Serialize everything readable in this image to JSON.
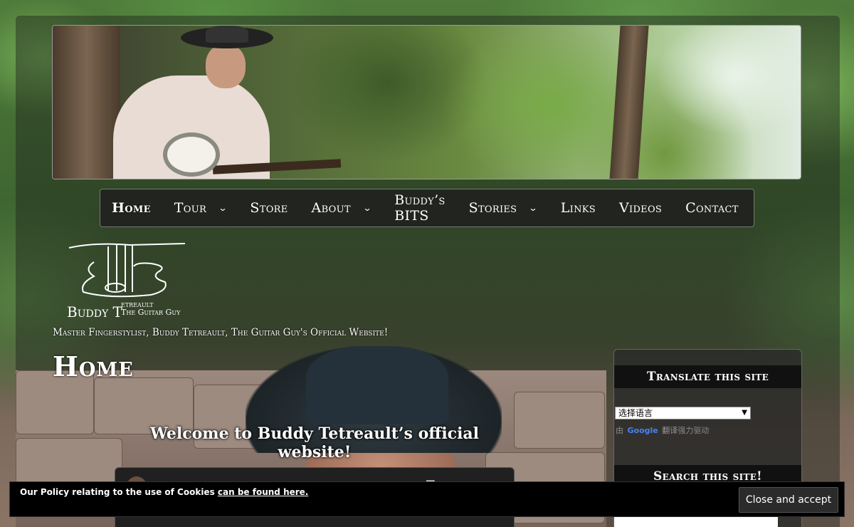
{
  "nav": {
    "items": [
      {
        "label": "Home",
        "has_submenu": false,
        "current": true
      },
      {
        "label": "Tour",
        "has_submenu": true
      },
      {
        "label": "Store",
        "has_submenu": false
      },
      {
        "label": "About",
        "has_submenu": true
      },
      {
        "label": "Buddy’s BITS",
        "has_submenu": false
      },
      {
        "label": "Stories",
        "has_submenu": true
      },
      {
        "label": "Links",
        "has_submenu": false
      },
      {
        "label": "Videos",
        "has_submenu": false
      },
      {
        "label": "Contact",
        "has_submenu": false
      }
    ]
  },
  "logo": {
    "name": "Buddy T",
    "name_rest": "etreault",
    "subtitle": "The Guitar Guy"
  },
  "tagline": "Master Fingerstylist, Buddy Tetreault, The Guitar Guy's Official Website!",
  "page_title": "Home",
  "welcome": "Welcome to Buddy Tetreault’s official website!",
  "sidebar": {
    "translate_title": "Translate this site",
    "language_select": "选择语言",
    "powered_prefix": "由",
    "google": "Google",
    "powered_translate": "翻译",
    "powered_suffix": "强力驱动",
    "search_title": "Search this site!"
  },
  "cookie": {
    "text": "Our Policy relating to the use of Cookies ",
    "link": "can be found here.",
    "button": "Close and accept"
  }
}
